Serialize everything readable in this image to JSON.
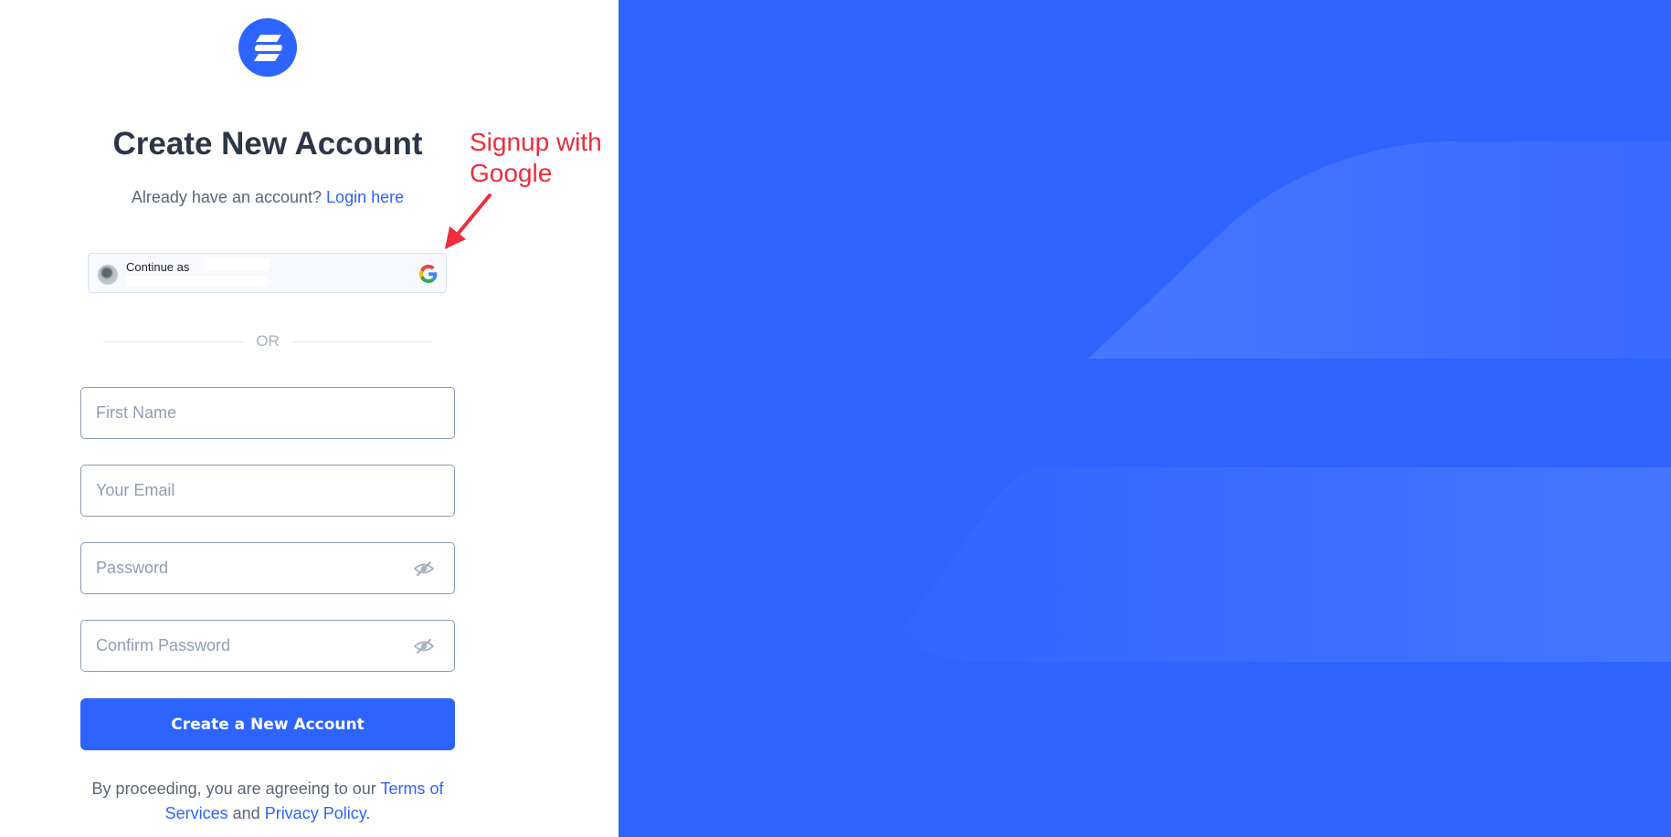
{
  "brand": {
    "logo_icon": "brand-logo-stripes-icon",
    "accent_color": "#2d64ff"
  },
  "header": {
    "title": "Create New Account",
    "login_prompt": "Already have an account?",
    "login_link": "Login here"
  },
  "annotation": {
    "line1": "Signup with",
    "line2": "Google",
    "arrow_icon": "red-arrow-icon",
    "color": "#ee2d3d"
  },
  "google_button": {
    "label": "Continue as",
    "avatar_icon": "user-avatar-icon",
    "provider_icon": "google-g-icon"
  },
  "divider": {
    "label": "OR"
  },
  "form": {
    "first_name": {
      "placeholder": "First Name",
      "value": ""
    },
    "email": {
      "placeholder": "Your Email",
      "value": ""
    },
    "password": {
      "placeholder": "Password",
      "value": "",
      "toggle_icon": "eye-slash-icon"
    },
    "confirm_password": {
      "placeholder": "Confirm Password",
      "value": "",
      "toggle_icon": "eye-slash-icon"
    },
    "submit_label": "Create a New Account"
  },
  "footer": {
    "prefix": "By proceeding, you are agreeing to our",
    "terms_link": "Terms of Services",
    "conjunction": "and",
    "privacy_link": "Privacy Policy",
    "suffix": "."
  }
}
